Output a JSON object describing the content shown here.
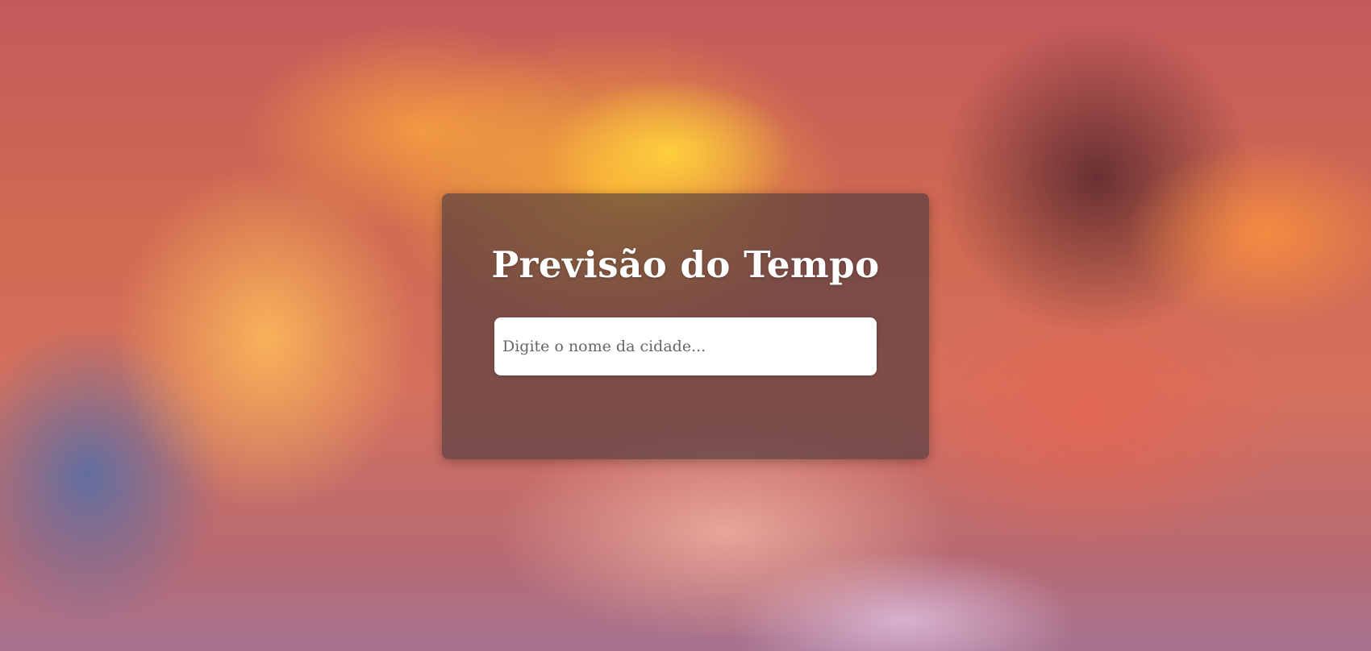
{
  "page": {
    "title": "Previsão do Tempo"
  },
  "search": {
    "value": "",
    "placeholder": "Digite o nome da cidade..."
  },
  "colors": {
    "card_background": "#463739",
    "title_text": "#ffffff",
    "input_background": "#ffffff",
    "placeholder_text": "#666666"
  },
  "background": {
    "description_icon": "sunset-clouds-background"
  }
}
